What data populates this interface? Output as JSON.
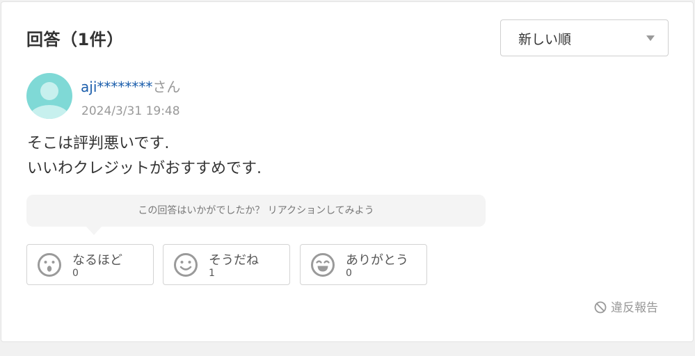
{
  "header": {
    "title": "回答（1件）",
    "sort_value": "新しい順"
  },
  "answer": {
    "user_id": "aji********",
    "user_suffix": "さん",
    "timestamp": "2024/3/31 19:48",
    "lines": [
      "そこは評判悪いです.",
      "いいわクレジットがおすすめです."
    ]
  },
  "reactions": {
    "prompt": "この回答はいかがでしたか？ リアクションしてみよう",
    "items": [
      {
        "label": "なるほど",
        "count": "0",
        "icon": "surprised-face-icon"
      },
      {
        "label": "そうだね",
        "count": "1",
        "icon": "smile-face-icon"
      },
      {
        "label": "ありがとう",
        "count": "0",
        "icon": "grin-face-icon"
      }
    ]
  },
  "footer": {
    "report_label": "違反報告",
    "report_icon": "prohibited-icon"
  },
  "colors": {
    "link": "#1a5dab",
    "muted": "#999999",
    "avatar": "#7fd9d6",
    "reaction_icon": "#9a9a9a"
  }
}
